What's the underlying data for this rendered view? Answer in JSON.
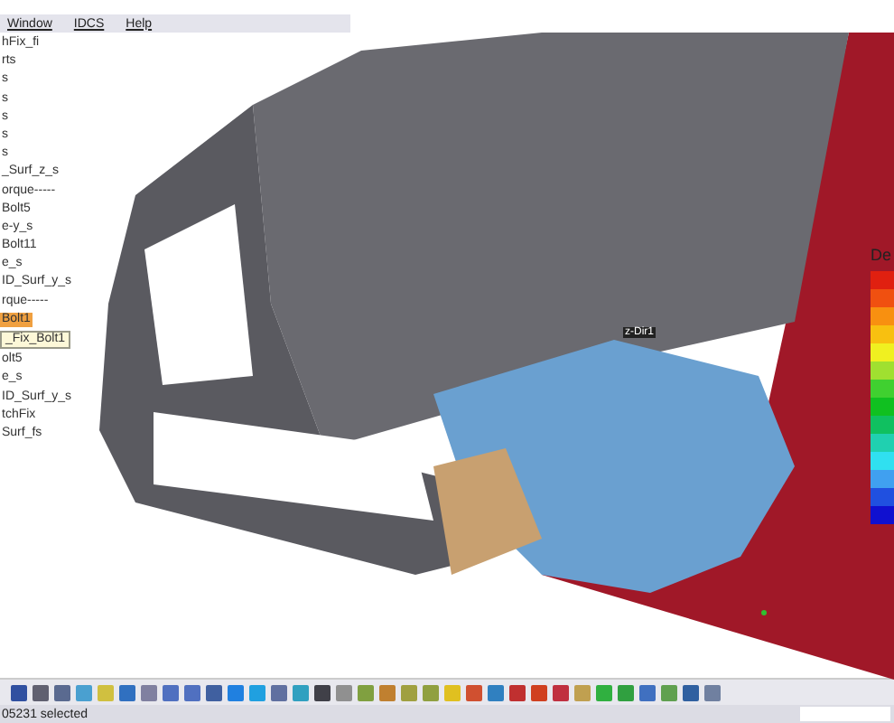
{
  "menu": [
    {
      "label": "Window"
    },
    {
      "label": "IDCS"
    },
    {
      "label": "Help"
    }
  ],
  "tree": [
    {
      "label": "hFix_fi",
      "selected": false
    },
    {
      "label": "rts",
      "selected": false
    },
    {
      "label": "s",
      "selected": false
    },
    {
      "label": "s",
      "selected": false
    },
    {
      "label": "s",
      "selected": false
    },
    {
      "label": "s",
      "selected": false
    },
    {
      "label": "s",
      "selected": false
    },
    {
      "label": "_Surf_z_s",
      "selected": false
    },
    {
      "label": "orque-----",
      "selected": false
    },
    {
      "label": "Bolt5",
      "selected": false
    },
    {
      "label": "e-y_s",
      "selected": false
    },
    {
      "label": "Bolt11",
      "selected": false
    },
    {
      "label": "e_s",
      "selected": false
    },
    {
      "label": "ID_Surf_y_s",
      "selected": false
    },
    {
      "label": "rque-----",
      "selected": false
    },
    {
      "label": "Bolt1",
      "selected": true
    },
    {
      "label": "olt5",
      "selected": false
    },
    {
      "label": "e_s",
      "selected": false
    },
    {
      "label": "ID_Surf_y_s",
      "selected": false
    },
    {
      "label": "tchFix",
      "selected": false
    },
    {
      "label": "Surf_fs",
      "selected": false
    }
  ],
  "tooltip": "_Fix_Bolt1",
  "viewport": {
    "direction_label": "z-Dir1"
  },
  "legend": {
    "title": "De",
    "scale": [
      {
        "color": "#e02010"
      },
      {
        "color": "#f05010"
      },
      {
        "color": "#f89010"
      },
      {
        "color": "#f8c010"
      },
      {
        "color": "#f0f020"
      },
      {
        "color": "#a0e030"
      },
      {
        "color": "#40d030"
      },
      {
        "color": "#10c020"
      },
      {
        "color": "#10c060"
      },
      {
        "color": "#20d0b0"
      },
      {
        "color": "#30e0f0"
      },
      {
        "color": "#40a0f0"
      },
      {
        "color": "#2050e0"
      },
      {
        "color": "#1010d0"
      }
    ]
  },
  "status_bar": {
    "text": "05231 selected"
  }
}
